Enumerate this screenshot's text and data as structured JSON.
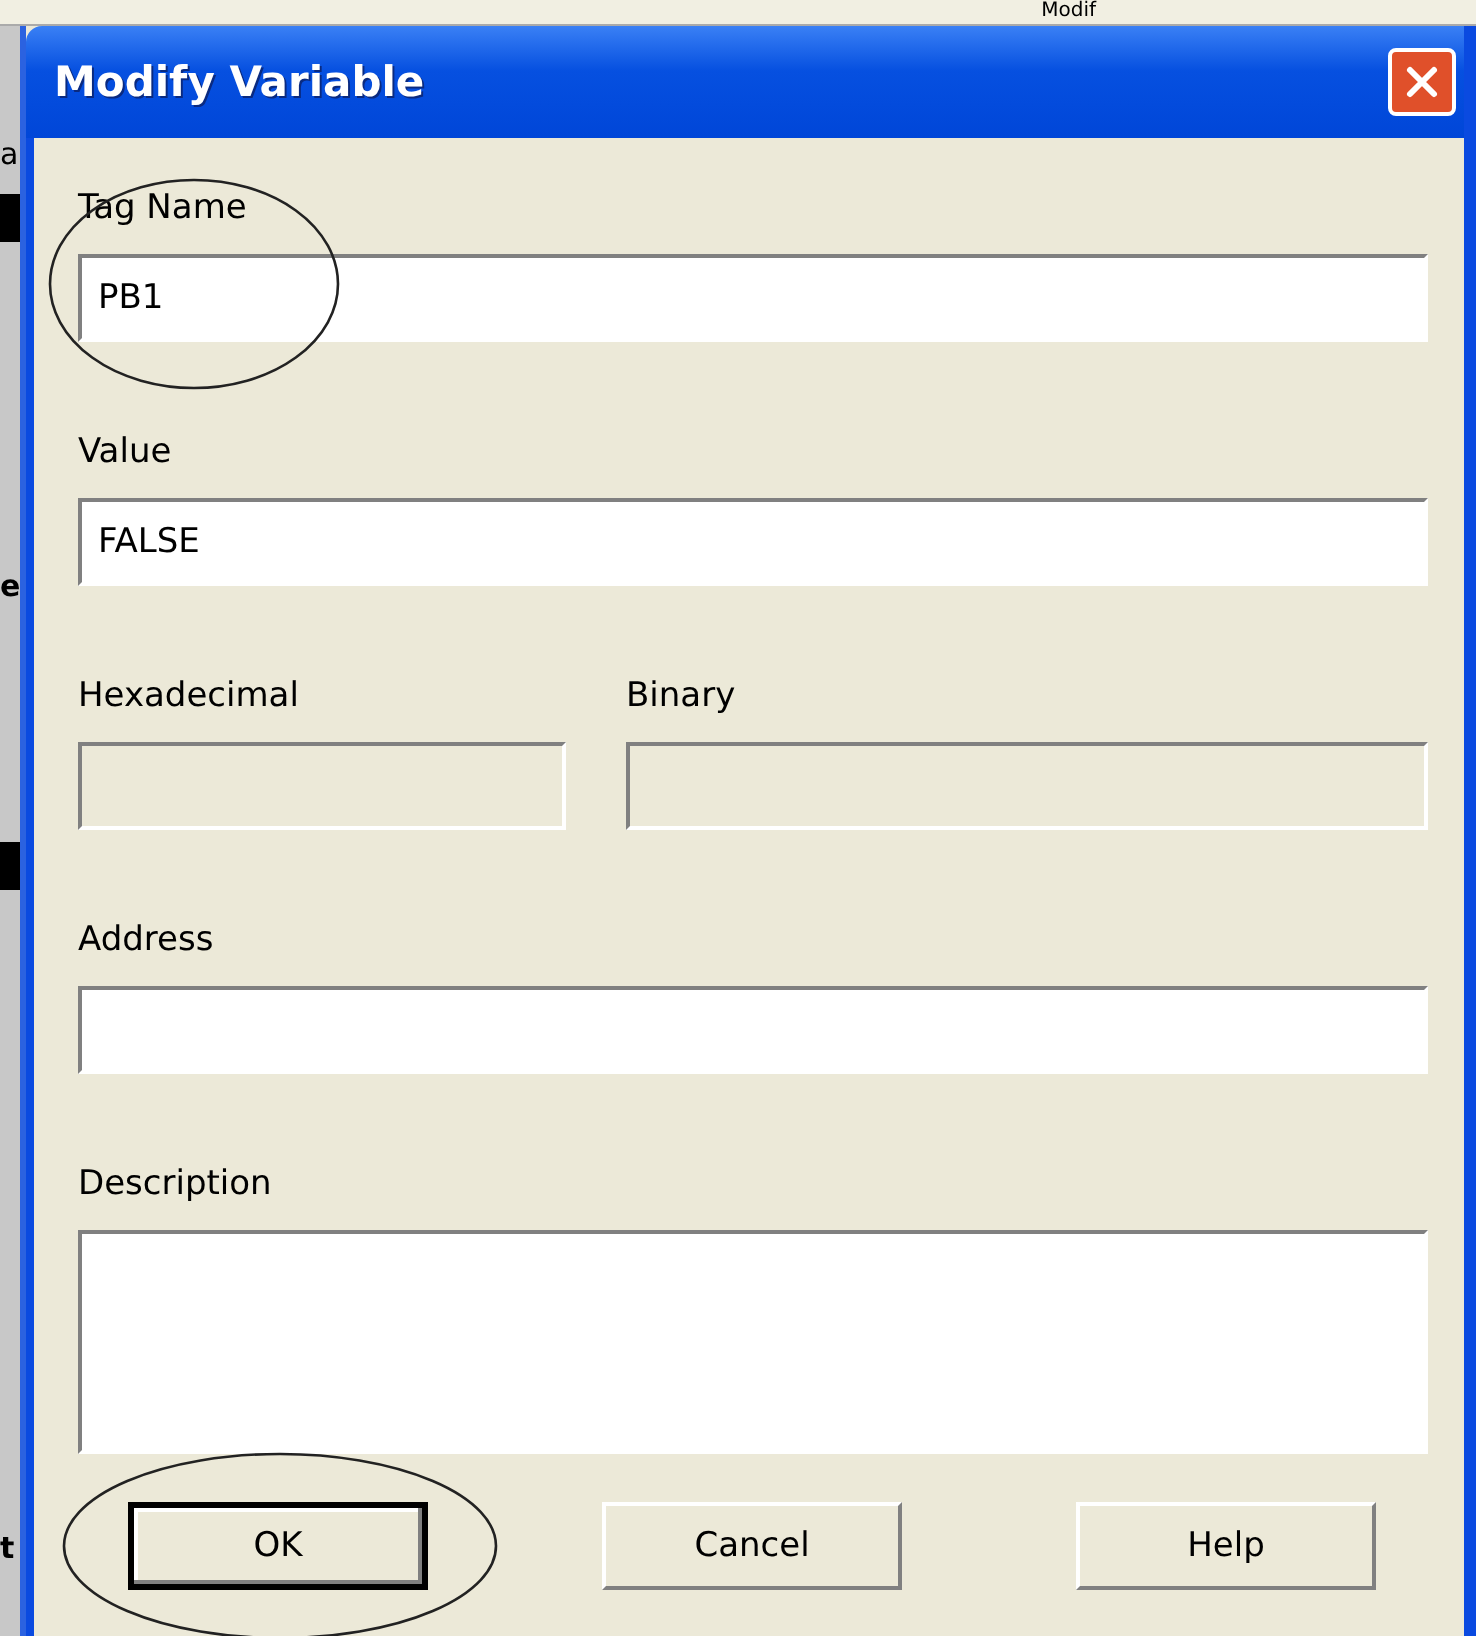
{
  "background": {
    "header_text": "Modif",
    "left_letters": [
      "a",
      "e",
      "t"
    ]
  },
  "window": {
    "title": "Modify Variable"
  },
  "rows": [
    [
      {
        "label": "Tag Name",
        "value": "PB1",
        "disabled": false,
        "kind": "text"
      }
    ],
    [
      {
        "label": "Value",
        "value": "FALSE",
        "disabled": false,
        "kind": "text"
      }
    ],
    [
      {
        "label": "Hexadecimal",
        "disabled": true,
        "kind": "text"
      },
      {
        "label": "Binary",
        "disabled": true,
        "kind": "text"
      }
    ],
    [
      {
        "label": "Address",
        "disabled": false,
        "kind": "text"
      }
    ],
    [
      {
        "label": "Description",
        "disabled": false,
        "kind": "textarea"
      }
    ]
  ],
  "buttons": [
    {
      "label": "OK",
      "default": true
    },
    {
      "label": "Cancel",
      "default": false
    },
    {
      "label": "Help",
      "default": false
    }
  ]
}
